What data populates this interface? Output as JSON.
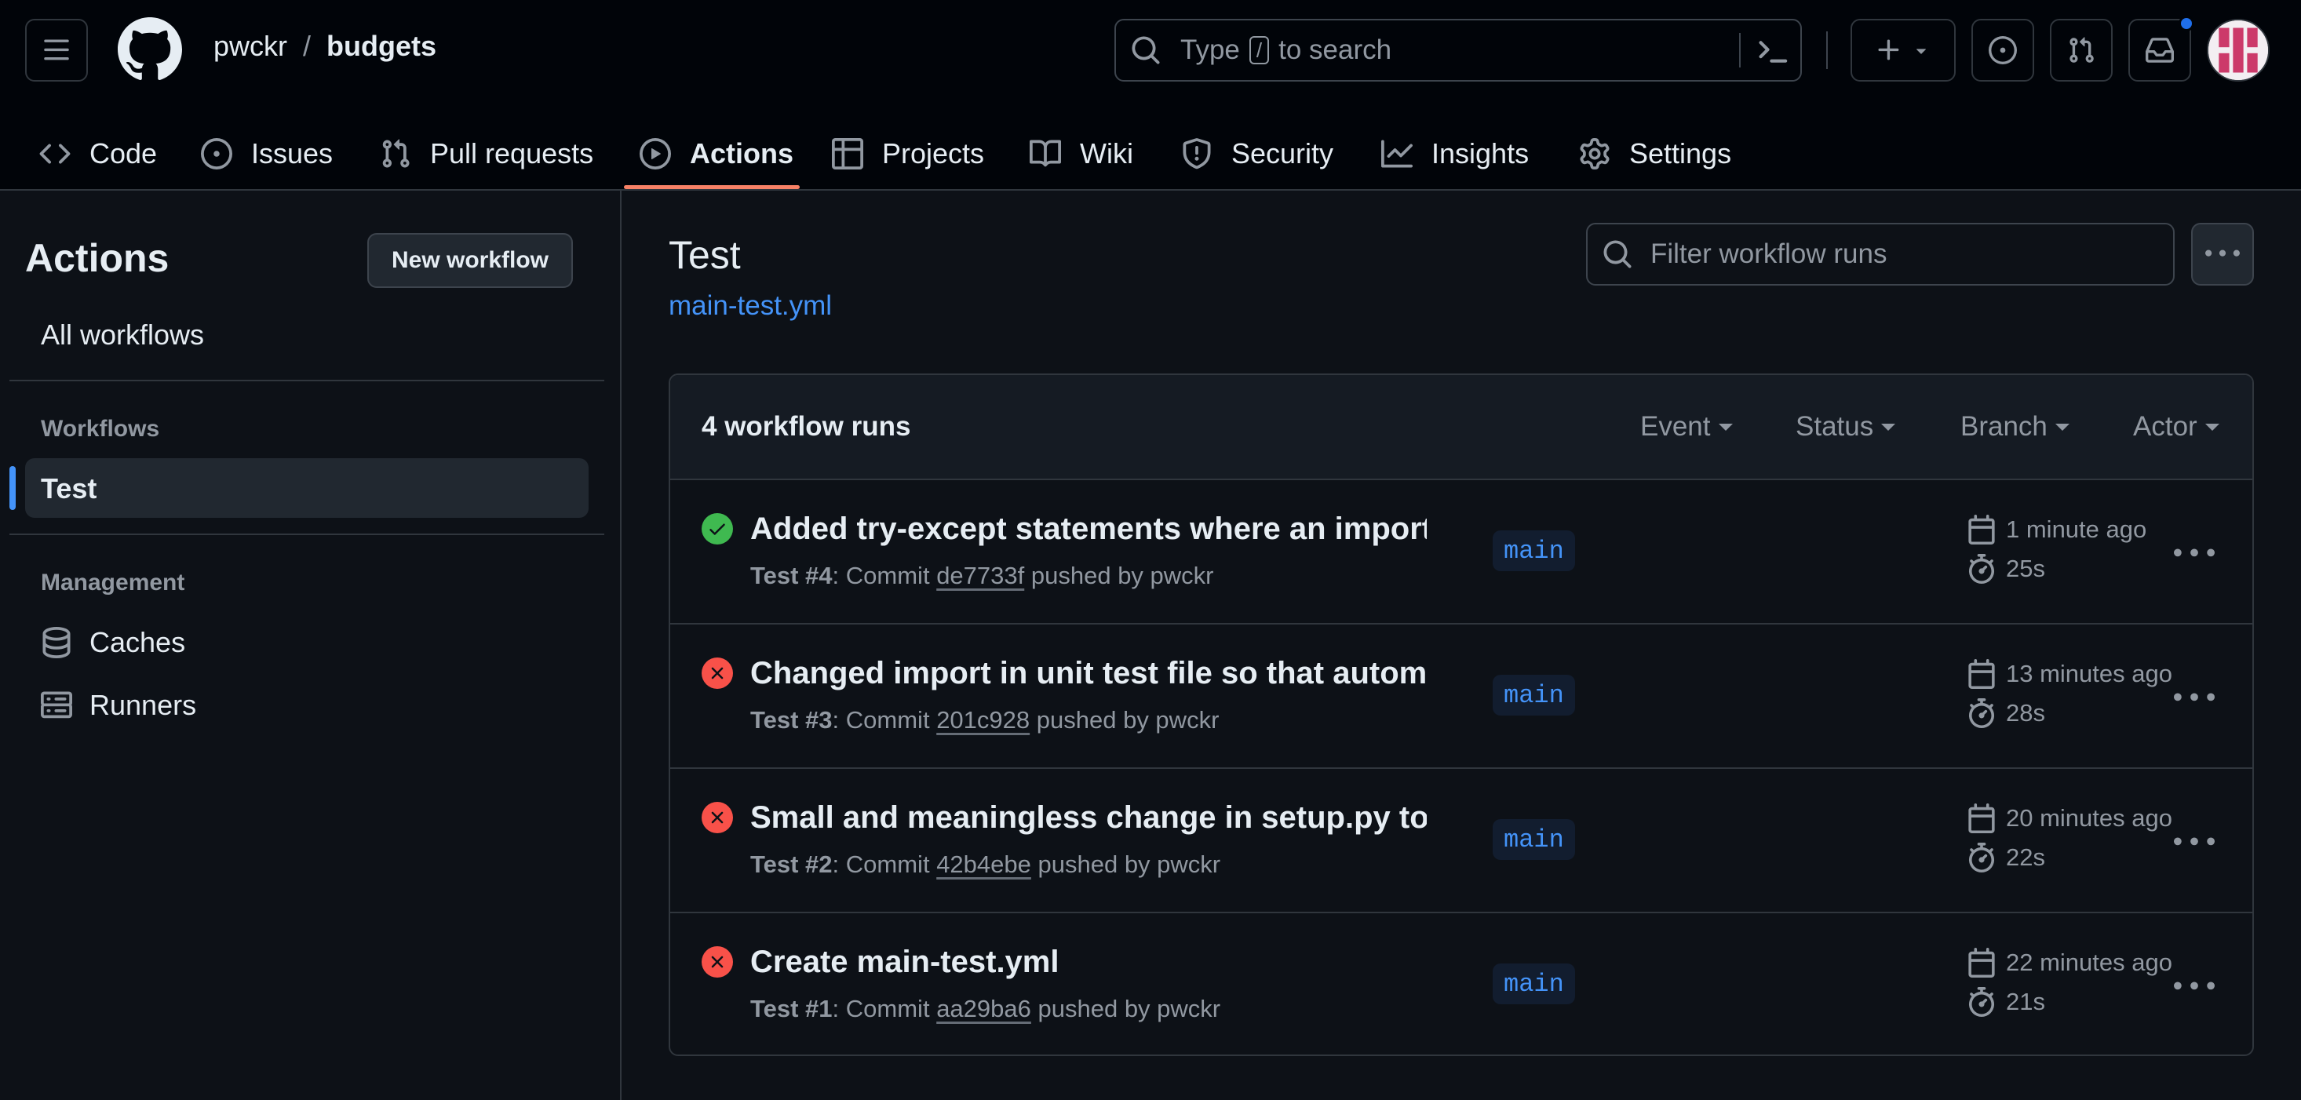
{
  "header": {
    "owner": "pwckr",
    "separator": "/",
    "repo": "budgets",
    "search_prefix": "Type",
    "search_key": "/",
    "search_suffix": "to search"
  },
  "tabs": [
    {
      "label": "Code",
      "icon": "code-icon"
    },
    {
      "label": "Issues",
      "icon": "issue-icon"
    },
    {
      "label": "Pull requests",
      "icon": "pull-request-icon"
    },
    {
      "label": "Actions",
      "icon": "play-icon",
      "selected": true
    },
    {
      "label": "Projects",
      "icon": "table-icon"
    },
    {
      "label": "Wiki",
      "icon": "book-icon"
    },
    {
      "label": "Security",
      "icon": "shield-icon"
    },
    {
      "label": "Insights",
      "icon": "graph-icon"
    },
    {
      "label": "Settings",
      "icon": "gear-icon"
    }
  ],
  "sidebar": {
    "title": "Actions",
    "new_workflow": "New workflow",
    "all_workflows": "All workflows",
    "workflows_heading": "Workflows",
    "selected_workflow": "Test",
    "management_heading": "Management",
    "caches": "Caches",
    "runners": "Runners"
  },
  "main": {
    "title": "Test",
    "file": "main-test.yml",
    "filter_placeholder": "Filter workflow runs",
    "count": "4 workflow runs",
    "filters": {
      "event": "Event",
      "status": "Status",
      "branch": "Branch",
      "actor": "Actor"
    },
    "runs": [
      {
        "status": "success",
        "title": "Added try-except statements where an import i…",
        "workflow": "Test #4",
        "label": "Commit",
        "commit": "de7733f",
        "pushed": "pushed by pwckr",
        "branch": "main",
        "time": "1 minute ago",
        "duration": "25s"
      },
      {
        "status": "failure",
        "title": "Changed import in unit test file so that automati…",
        "workflow": "Test #3",
        "label": "Commit",
        "commit": "201c928",
        "pushed": "pushed by pwckr",
        "branch": "main",
        "time": "13 minutes ago",
        "duration": "28s"
      },
      {
        "status": "failure",
        "title": "Small and meaningless change in setup.py to te…",
        "workflow": "Test #2",
        "label": "Commit",
        "commit": "42b4ebe",
        "pushed": "pushed by pwckr",
        "branch": "main",
        "time": "20 minutes ago",
        "duration": "22s"
      },
      {
        "status": "failure",
        "title": "Create main-test.yml",
        "workflow": "Test #1",
        "label": "Commit",
        "commit": "aa29ba6",
        "pushed": "pushed by pwckr",
        "branch": "main",
        "time": "22 minutes ago",
        "duration": "21s"
      }
    ]
  },
  "colors": {
    "success": "#3fb950",
    "failure": "#f85149",
    "accent": "#4493f8",
    "tab_underline": "#f78166"
  }
}
